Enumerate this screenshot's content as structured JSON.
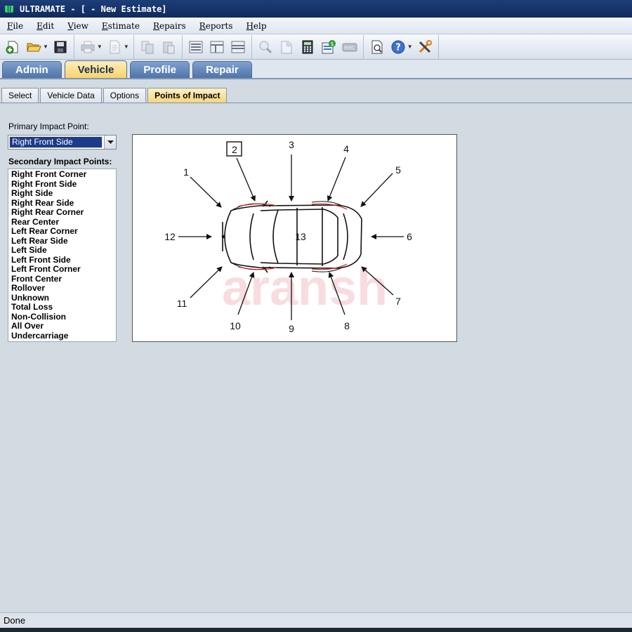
{
  "window": {
    "title": "ULTRAMATE - [ - New Estimate]"
  },
  "menu": [
    "File",
    "Edit",
    "View",
    "Estimate",
    "Repairs",
    "Reports",
    "Help"
  ],
  "toolbar": {
    "icons": [
      "new-estimate-icon",
      "open-folder-icon",
      "save-icon",
      "print-icon",
      "print-preview-icon",
      "copy-icon",
      "paste-icon",
      "list-view-icon",
      "split-view-icon",
      "panel-view-icon",
      "search-icon",
      "estimate-doc-icon",
      "calculator-icon",
      "totals-icon",
      "rmc-icon",
      "report-icon",
      "help-icon",
      "tools-icon"
    ],
    "rmc_label": "RMC"
  },
  "main_tabs": [
    {
      "label": "Admin",
      "active": false
    },
    {
      "label": "Vehicle",
      "active": true
    },
    {
      "label": "Profile",
      "active": false
    },
    {
      "label": "Repair",
      "active": false
    }
  ],
  "sub_tabs": [
    {
      "label": "Select",
      "active": false
    },
    {
      "label": "Vehicle Data",
      "active": false
    },
    {
      "label": "Options",
      "active": false
    },
    {
      "label": "Points of Impact",
      "active": true
    }
  ],
  "primary": {
    "label": "Primary Impact Point:",
    "value": "Right Front Side"
  },
  "secondary": {
    "label": "Secondary Impact Points:",
    "items": [
      "Right Front Corner",
      "Right Front Side",
      "Right Side",
      "Right Rear Side",
      "Right Rear Corner",
      "Rear Center",
      "Left Rear Corner",
      "Left Rear Side",
      "Left Side",
      "Left Front Side",
      "Left Front Corner",
      "Front Center",
      "Rollover",
      "Unknown",
      "Total Loss",
      "Non-Collision",
      "All Over",
      "Undercarriage"
    ]
  },
  "diagram": {
    "points": [
      "1",
      "2",
      "3",
      "4",
      "5",
      "6",
      "7",
      "8",
      "9",
      "10",
      "11",
      "12",
      "13"
    ],
    "selected_point": "2",
    "watermark": "aransh"
  },
  "status": {
    "text": "Done"
  },
  "colors": {
    "title_bar": "#1d3e78",
    "active_tab": "#f9d36b",
    "tab": "#4f74a9",
    "selection": "#1b3b8c",
    "background": "#d2dae2"
  }
}
